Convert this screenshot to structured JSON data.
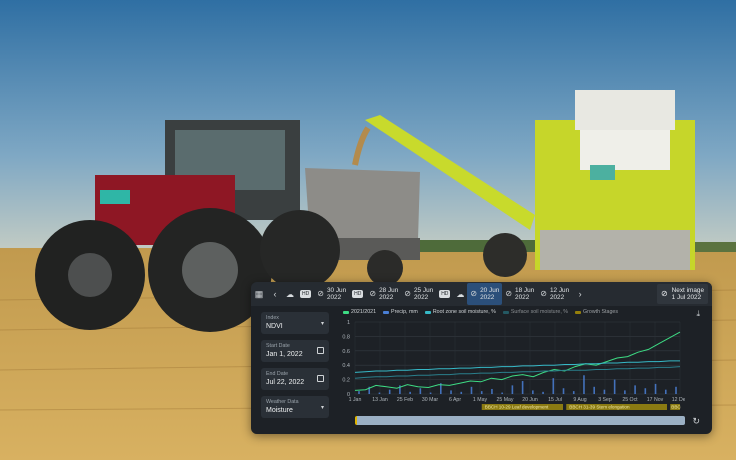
{
  "toolbar": {
    "dates": [
      {
        "day": "30 Jun",
        "year": "2022",
        "active": false
      },
      {
        "day": "28 Jun",
        "year": "2022",
        "active": false
      },
      {
        "day": "25 Jun",
        "year": "2022",
        "active": false
      },
      {
        "day": "20 Jun",
        "year": "2022",
        "active": true
      },
      {
        "day": "18 Jun",
        "year": "2022",
        "active": false
      },
      {
        "day": "12 Jun",
        "year": "2022",
        "active": false
      }
    ],
    "badges": [
      "HD",
      "HD",
      "HD"
    ],
    "next_label": "Next image",
    "next_date": "1 Jul 2022"
  },
  "sidebar": {
    "index": {
      "label": "Index",
      "value": "NDVI"
    },
    "start": {
      "label": "Start Date",
      "value": "Jan 1, 2022"
    },
    "end": {
      "label": "End Date",
      "value": "Jul 22, 2022"
    },
    "weather": {
      "label": "Weather Data",
      "value": "Moisture"
    }
  },
  "legend": [
    {
      "label": "2021/2021",
      "color": "#3ddc84"
    },
    {
      "label": "Precip, mm",
      "color": "#4a7fd6"
    },
    {
      "label": "Root zone soil moisture, %",
      "color": "#36b9c7"
    },
    {
      "label": "Surface soil moisture, %",
      "color": "#2a7f8c"
    },
    {
      "label": "Growth Stages",
      "color": "#c9a800"
    }
  ],
  "chart_data": {
    "type": "line",
    "x_tick_labels": [
      "1 Jan",
      "13 Jan",
      "25 Feb",
      "30 Mar",
      "6 Apr",
      "1 May",
      "25 May",
      "20 Jun",
      "15 Jul",
      "9 Aug",
      "3 Sep",
      "25 Oct",
      "17 Nov",
      "12 Dec"
    ],
    "y_tick_labels": [
      "1",
      "0.8",
      "0.6",
      "0.4",
      "0.2",
      "0"
    ],
    "ylim": [
      0,
      1
    ],
    "series": [
      {
        "name": "2021/2021",
        "color": "#3ddc84",
        "values": [
          0.05,
          0.06,
          0.12,
          0.1,
          0.08,
          0.13,
          0.1,
          0.09,
          0.13,
          0.12,
          0.15,
          0.18,
          0.17,
          0.22,
          0.2,
          0.25,
          0.27,
          0.24,
          0.3,
          0.34,
          0.32,
          0.38,
          0.42,
          0.4,
          0.45,
          0.5,
          0.52,
          0.58,
          0.62,
          0.7,
          0.78,
          0.86
        ]
      },
      {
        "name": "Root zone soil moisture, %",
        "color": "#36b9c7",
        "values": [
          0.3,
          0.31,
          0.32,
          0.32,
          0.33,
          0.33,
          0.34,
          0.34,
          0.35,
          0.35,
          0.36,
          0.36,
          0.37,
          0.37,
          0.38,
          0.38,
          0.39,
          0.39,
          0.4,
          0.4,
          0.41,
          0.41,
          0.42,
          0.42,
          0.43,
          0.43,
          0.44,
          0.44,
          0.45,
          0.45,
          0.46,
          0.46
        ]
      },
      {
        "name": "Surface soil moisture, %",
        "color": "#2a7f8c",
        "values": [
          0.22,
          0.23,
          0.24,
          0.24,
          0.25,
          0.25,
          0.26,
          0.26,
          0.27,
          0.27,
          0.28,
          0.28,
          0.29,
          0.29,
          0.3,
          0.3,
          0.31,
          0.31,
          0.32,
          0.32,
          0.33,
          0.33,
          0.33,
          0.34,
          0.34,
          0.35,
          0.35,
          0.36,
          0.36,
          0.37,
          0.37,
          0.38
        ]
      }
    ],
    "bars": {
      "name": "Precip, mm",
      "color": "#4a7fd6",
      "values": [
        0.04,
        0.1,
        0.02,
        0.06,
        0.12,
        0.03,
        0.08,
        0.02,
        0.15,
        0.05,
        0.03,
        0.1,
        0.04,
        0.07,
        0.02,
        0.12,
        0.18,
        0.05,
        0.03,
        0.22,
        0.08,
        0.04,
        0.26,
        0.1,
        0.06,
        0.2,
        0.05,
        0.12,
        0.08,
        0.14,
        0.06,
        0.1
      ]
    },
    "growth_stages": [
      {
        "label": "BBCH 10-29 Leaf development",
        "start": 0.39,
        "end": 0.64
      },
      {
        "label": "BBCH 31-39 Stem elongation",
        "start": 0.65,
        "end": 0.96
      }
    ],
    "stage_end_label": "BBC"
  }
}
